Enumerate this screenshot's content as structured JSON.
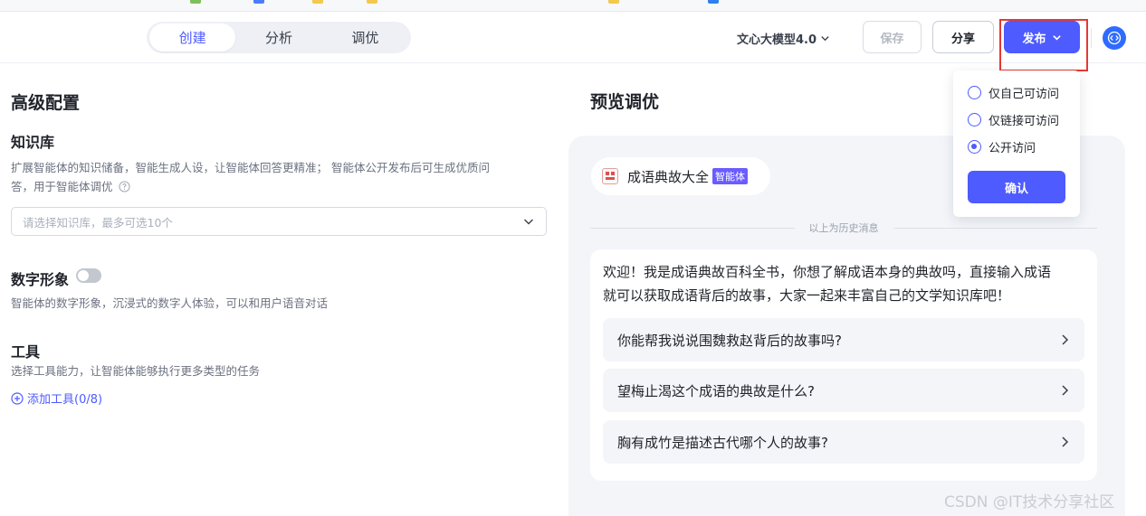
{
  "header": {
    "tabs": [
      {
        "label": "创建",
        "active": true
      },
      {
        "label": "分析",
        "active": false
      },
      {
        "label": "调优",
        "active": false
      }
    ],
    "model_label": "文心大模型4.0",
    "save_label": "保存",
    "share_label": "分享",
    "publish_label": "发布"
  },
  "config": {
    "title": "高级配置",
    "knowledge": {
      "title": "知识库",
      "desc_line1": "扩展智能体的知识储备，智能生成人设，让智能体回答更精准； 智能体公开发布后可生成优质问",
      "desc_line2": "答，用于智能体调优",
      "select_placeholder": "请选择知识库，最多可选10个"
    },
    "digital": {
      "title": "数字形象",
      "enabled": false,
      "desc": "智能体的数字形象，沉浸式的数字人体验，可以和用户语音对话"
    },
    "tools": {
      "title": "工具",
      "desc": "选择工具能力，让智能体能够执行更多类型的任务",
      "add_label": "添加工具(0/8)"
    }
  },
  "preview": {
    "title": "预览调优",
    "agent_name": "成语典故大全",
    "agent_badge": "智能体",
    "history_label": "以上为历史消息",
    "welcome_line1": "欢迎！我是成语典故百科全书，你想了解成语本身的典故吗，直接输入成语",
    "welcome_line2": "就可以获取成语背后的故事，大家一起来丰富自己的文学知识库吧！",
    "suggestions": [
      "你能帮我说说围魏救赵背后的故事吗?",
      "望梅止渴这个成语的典故是什么?",
      "胸有成竹是描述古代哪个人的故事?"
    ]
  },
  "publish_menu": {
    "options": [
      {
        "label": "仅自己可访问",
        "selected": false
      },
      {
        "label": "仅链接可访问",
        "selected": false
      },
      {
        "label": "公开访问",
        "selected": true
      }
    ],
    "confirm_label": "确认"
  },
  "watermark": "CSDN @IT技术分享社区",
  "colors": {
    "accent": "#4d5bff",
    "highlight_border": "#e53935",
    "badge": "#6a5cff"
  }
}
